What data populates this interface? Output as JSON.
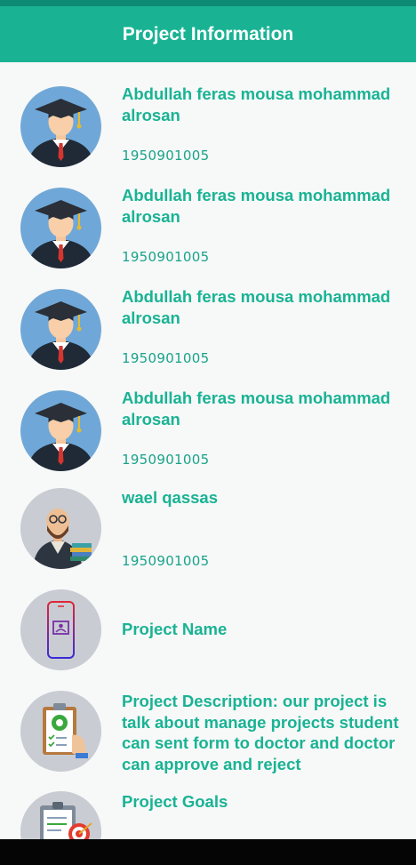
{
  "appbar": {
    "title": "Project Information"
  },
  "students": [
    {
      "name": "Abdullah feras mousa mohammad alrosan",
      "id": "1950901005",
      "icon": "graduate-avatar-icon"
    },
    {
      "name": "Abdullah feras mousa mohammad alrosan",
      "id": "1950901005",
      "icon": "graduate-avatar-icon"
    },
    {
      "name": "Abdullah feras mousa mohammad alrosan",
      "id": "1950901005",
      "icon": "graduate-avatar-icon"
    },
    {
      "name": "Abdullah feras mousa mohammad alrosan",
      "id": "1950901005",
      "icon": "graduate-avatar-icon"
    }
  ],
  "supervisor": {
    "name": "wael qassas",
    "id": "1950901005",
    "icon": "teacher-avatar-icon"
  },
  "project": {
    "name_label": "Project Name",
    "name_icon": "phone-icon",
    "description": "Project Description: our project is talk about manage projects student can sent form to doctor and doctor can approve and reject",
    "description_icon": "clipboard-settings-icon",
    "goals_label": "Project Goals",
    "goals_icon": "clipboard-target-icon"
  },
  "colors": {
    "primary": "#19b394",
    "status_bar": "#0c8a74",
    "background": "#f7f8f8",
    "avatar_bg": "#c9cdd3"
  }
}
